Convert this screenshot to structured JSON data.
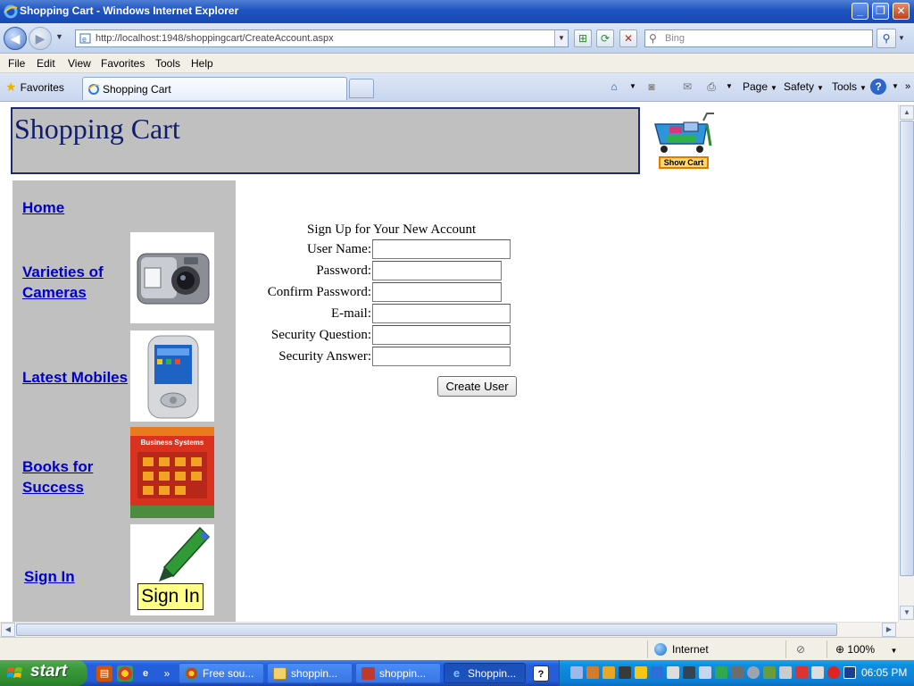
{
  "window": {
    "title": "Shopping Cart - Windows Internet Explorer"
  },
  "address": {
    "url": "http://localhost:1948/shoppingcart/CreateAccount.aspx",
    "search_placeholder": "Bing"
  },
  "menu": {
    "items": [
      "File",
      "Edit",
      "View",
      "Favorites",
      "Tools",
      "Help"
    ]
  },
  "commandbar": {
    "favorites_label": "Favorites",
    "tab_label": "Shopping Cart",
    "page_label": "Page",
    "safety_label": "Safety",
    "tools_label": "Tools"
  },
  "page": {
    "header_title": "Shopping Cart",
    "cart_button_label": "Show Cart",
    "sidebar": {
      "home": "Home",
      "cameras": "Varieties of Cameras",
      "mobiles": "Latest Mobiles",
      "books": "Books for Success",
      "signin": "Sign In",
      "book_cover_title": "Business Systems",
      "signin_image_text": "Sign In"
    },
    "form": {
      "heading": "Sign Up for Your New Account",
      "username_label": "User Name:",
      "password_label": "Password:",
      "confirm_label": "Confirm Password:",
      "email_label": "E-mail:",
      "question_label": "Security Question:",
      "answer_label": "Security Answer:",
      "username_value": "",
      "password_value": "",
      "confirm_value": "",
      "email_value": "",
      "question_value": "",
      "answer_value": "",
      "submit_label": "Create User"
    }
  },
  "status": {
    "zone": "Internet",
    "zoom": "100%"
  },
  "taskbar": {
    "start_label": "start",
    "items": [
      "Free sou...",
      "shoppin...",
      "shoppin...",
      "Shoppin..."
    ],
    "clock": "06:05 PM"
  },
  "colors": {
    "header_bg": "#c0c0c0",
    "header_title": "#101c6c",
    "link": "#0000cc",
    "taskbar": "#245edb"
  }
}
